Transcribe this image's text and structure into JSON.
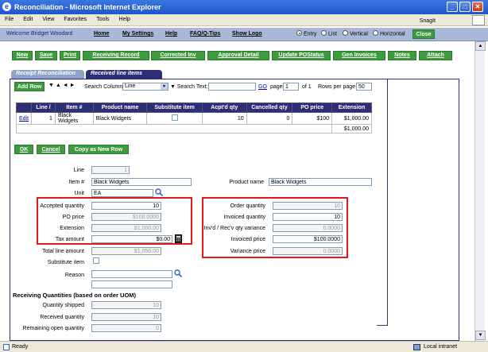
{
  "window": {
    "title": "Reconciliation - Microsoft Internet Explorer"
  },
  "menu": [
    "File",
    "Edit",
    "View",
    "Favorites",
    "Tools",
    "Help"
  ],
  "snagit": "SnagIt",
  "header": {
    "welcome": "Welcome Bridget Woodard",
    "links": [
      "Home",
      "My Settings",
      "Help",
      "FAQ/Q-Tips",
      "Show Logo"
    ],
    "view_options": [
      "Entry",
      "List",
      "Vertical",
      "Horizontal"
    ],
    "selected_view": "Entry",
    "close": "Close"
  },
  "toolbar": [
    "New",
    "Save",
    "Print",
    "Receiving Record",
    "Corrected Inv",
    "Approval Detail",
    "Update POStatus",
    "Gen Invoices",
    "Notes",
    "Attach"
  ],
  "tabs": [
    "Receipt Reconciliation",
    "Received line items"
  ],
  "grid_controls": {
    "add_row": "Add Row",
    "search_column_label": "Search Column:",
    "search_column_value": "Line",
    "search_text_label": "Search Text:",
    "search_text_value": "",
    "go": "GO",
    "page_label": "page",
    "page_value": "1",
    "of_pages": "of 1",
    "rows_per_page_label": "Rows per page",
    "rows_per_page_value": "50"
  },
  "table": {
    "columns": [
      "",
      "Line",
      "Item #",
      "Product name",
      "Substitute item",
      "Acpt'd qty",
      "Cancelled qty",
      "PO price",
      "Extension"
    ],
    "rows": [
      {
        "edit": "Edit",
        "line": "1",
        "item": "Black Widgets",
        "product": "Black Widgets",
        "acpt_qty": "10",
        "cancelled_qty": "0",
        "po_price": "$100",
        "extension": "$1,000.00"
      }
    ],
    "total": "$1,000.00"
  },
  "actions": [
    "OK",
    "Cancel",
    "Copy as New Row"
  ],
  "form": {
    "line_label": "Line",
    "line_value": "1",
    "item_label": "Item #",
    "item_value": "Black Widgets",
    "product_label": "Product name",
    "product_value": "Black Widgets",
    "unit_label": "Unit",
    "unit_value": "EA",
    "accepted_qty_label": "Accepted quantity",
    "accepted_qty_value": "10",
    "po_price_label": "PO price",
    "po_price_value": "$100.0000",
    "extension_label": "Extension",
    "extension_value": "$1,000.00",
    "tax_label": "Tax amount",
    "tax_value": "$0.00",
    "total_line_label": "Total line amount",
    "total_line_value": "$1,050.00",
    "substitute_label": "Substitute item",
    "reason_label": "Reason",
    "reason_value": "",
    "order_qty_label": "Order quantity",
    "order_qty_value": "10",
    "invoiced_qty_label": "Invoiced quantity",
    "invoiced_qty_value": "10",
    "variance_label": "Inv'd / Rec'v qty variance",
    "variance_value": "0.0000",
    "invoiced_price_label": "Invoiced price",
    "invoiced_price_value": "$100.0000",
    "variance_price_label": "Variance price",
    "variance_price_value": "0.0000"
  },
  "receiving": {
    "heading": "Receiving Quantities (based on order UOM)",
    "shipped_label": "Quantity shipped",
    "shipped_value": "10",
    "received_label": "Received quantity",
    "received_value": "10",
    "remaining_label": "Remaining open quantity",
    "remaining_value": "0"
  },
  "status": {
    "left": "Ready",
    "zone": "Local intranet"
  },
  "colors": {
    "accent_green": "#3d9b3d",
    "header_navy": "#2e2e78",
    "highlight_red": "#e01818"
  }
}
